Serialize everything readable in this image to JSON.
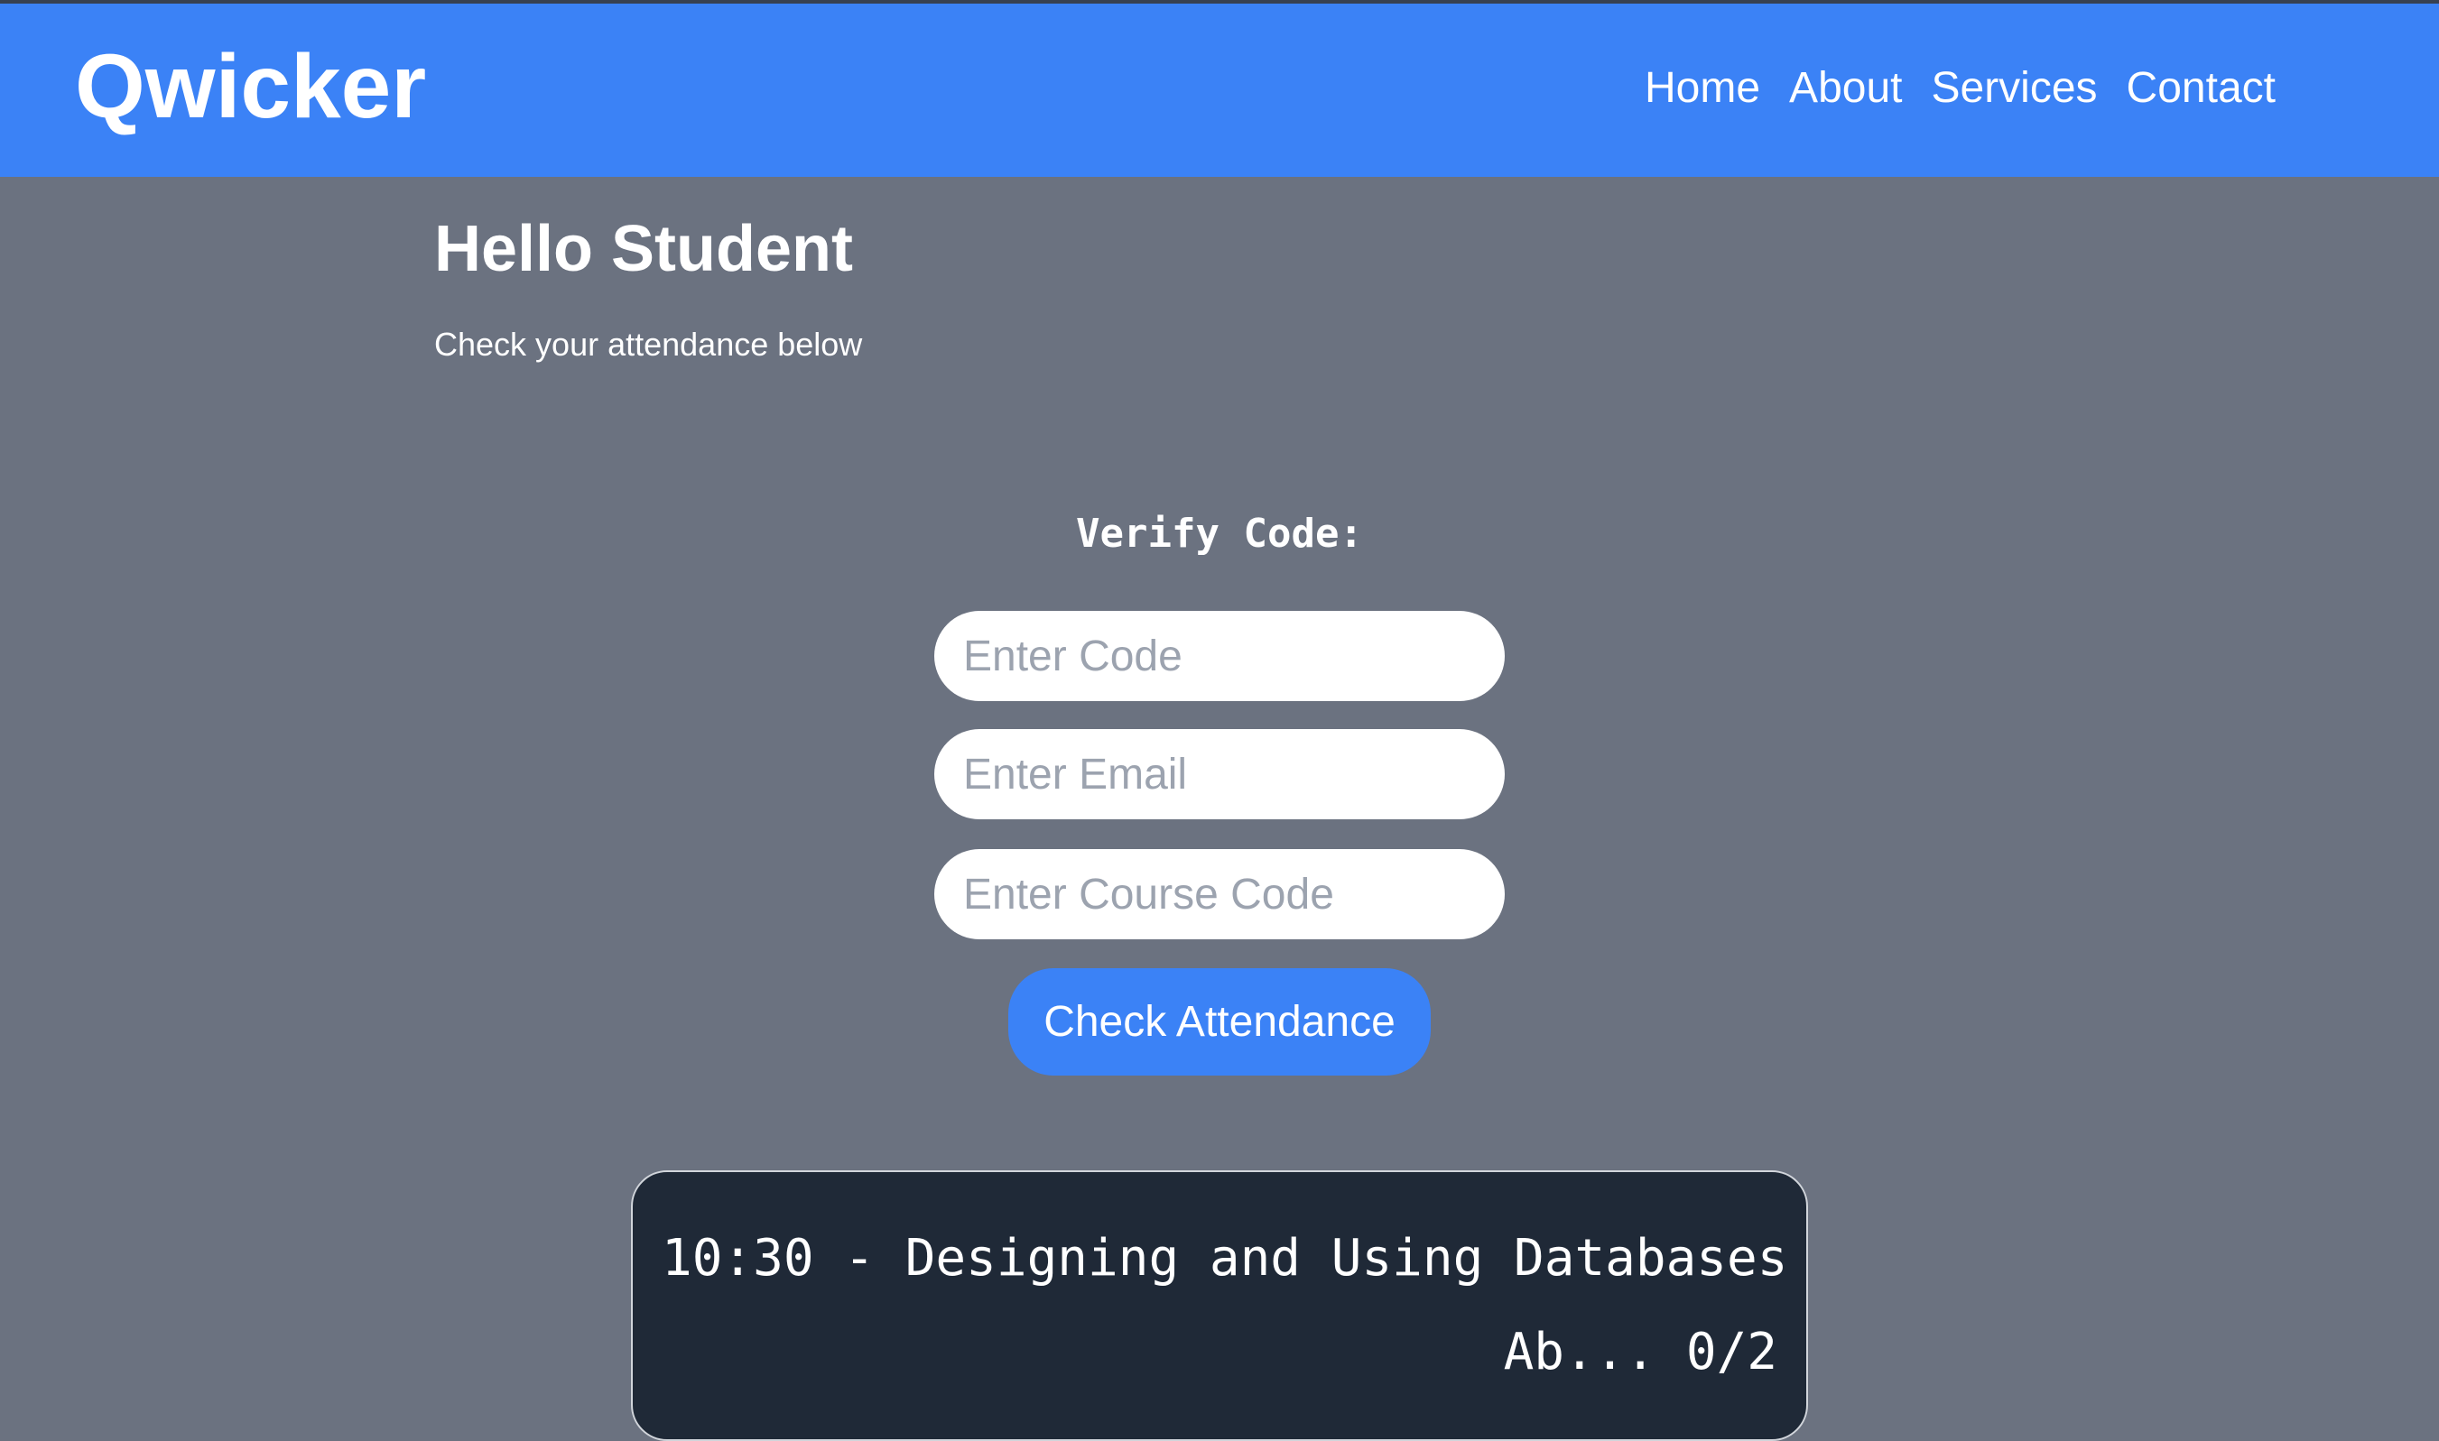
{
  "header": {
    "logo": "Qwicker",
    "nav": [
      {
        "label": "Home"
      },
      {
        "label": "About"
      },
      {
        "label": "Services"
      },
      {
        "label": "Contact"
      }
    ]
  },
  "main": {
    "greeting": "Hello Student",
    "subtitle": "Check your attendance below",
    "verify_label": "Verify Code:",
    "fields": [
      {
        "placeholder": "Enter Code",
        "value": ""
      },
      {
        "placeholder": "Enter Email",
        "value": ""
      },
      {
        "placeholder": "Enter Course Code",
        "value": ""
      }
    ],
    "check_button": "Check Attendance"
  },
  "attendance_card": {
    "title": "10:30 - Designing and Using Databases",
    "status_partial": "Ab...  0/2"
  },
  "colors": {
    "header_bg": "#3B82F6",
    "page_bg": "#6B7280",
    "card_bg": "#1F2937",
    "button_bg": "#3B82F6",
    "placeholder": "#9CA3AF"
  }
}
